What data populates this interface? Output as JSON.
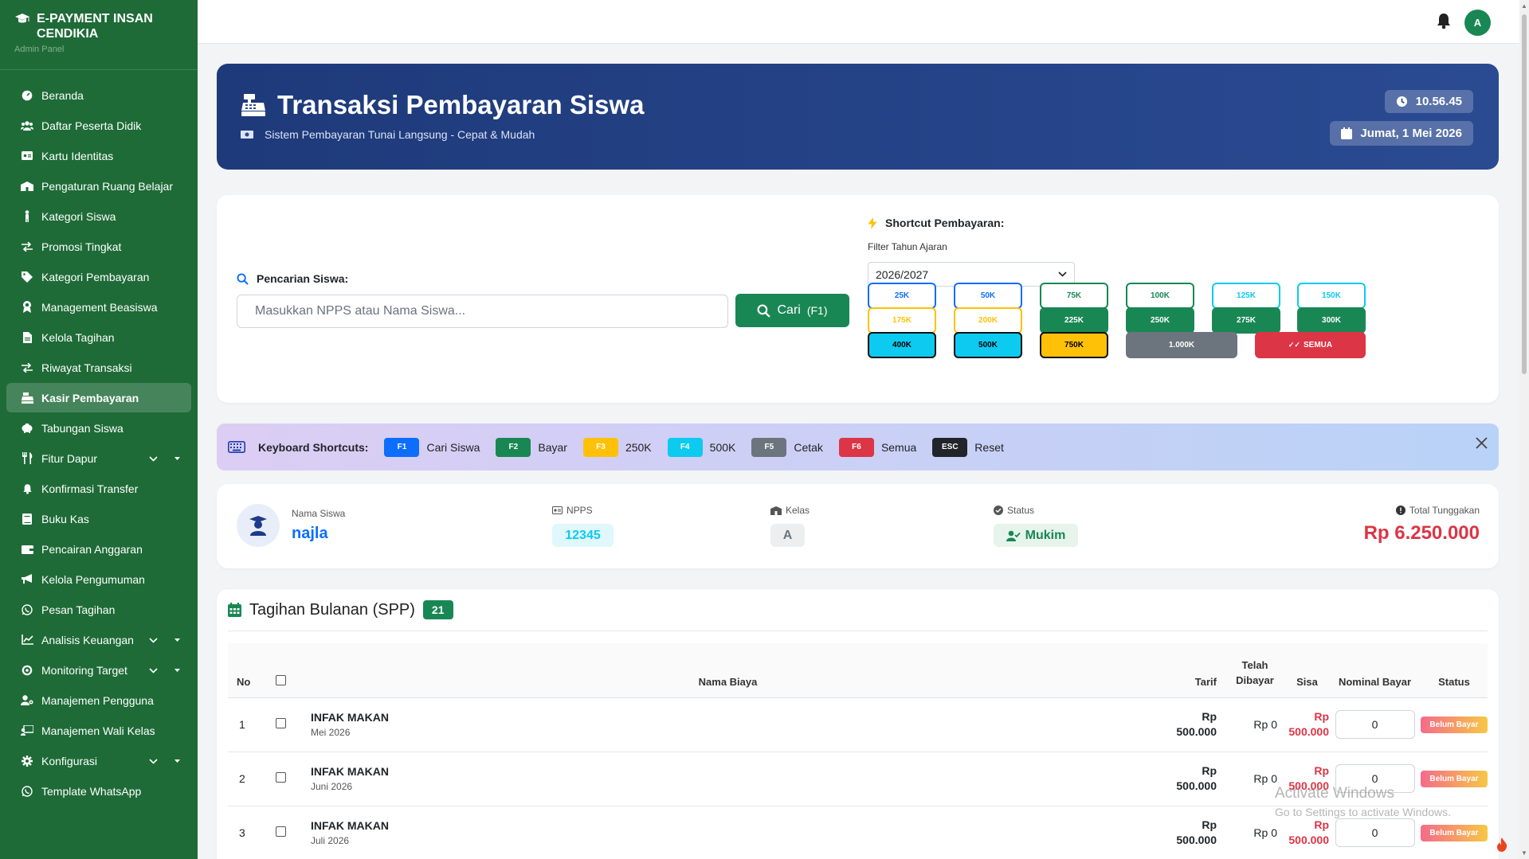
{
  "brand": {
    "title": "E-PAYMENT INSAN CENDIKIA",
    "subtitle": "Admin Panel"
  },
  "sidebar": {
    "items": [
      {
        "label": "Beranda",
        "icon": "gauge-icon"
      },
      {
        "label": "Daftar Peserta Didik",
        "icon": "users-icon"
      },
      {
        "label": "Kartu Identitas",
        "icon": "id-card-icon"
      },
      {
        "label": "Pengaturan Ruang Belajar",
        "icon": "school-icon"
      },
      {
        "label": "Kategori Siswa",
        "icon": "child-icon"
      },
      {
        "label": "Promosi Tingkat",
        "icon": "exchange-icon"
      },
      {
        "label": "Kategori Pembayaran",
        "icon": "tag-icon"
      },
      {
        "label": "Management Beasiswa",
        "icon": "award-icon"
      },
      {
        "label": "Kelola Tagihan",
        "icon": "file-icon"
      },
      {
        "label": "Riwayat Transaksi",
        "icon": "exchange-icon"
      },
      {
        "label": "Kasir Pembayaran",
        "icon": "cash-register-icon",
        "active": true
      },
      {
        "label": "Tabungan Siswa",
        "icon": "piggy-bank-icon"
      },
      {
        "label": "Fitur Dapur",
        "icon": "utensils-icon",
        "expandable": true
      },
      {
        "label": "Konfirmasi Transfer",
        "icon": "bell-icon"
      },
      {
        "label": "Buku Kas",
        "icon": "book-icon"
      },
      {
        "label": "Pencairan Anggaran",
        "icon": "wallet-icon"
      },
      {
        "label": "Kelola Pengumuman",
        "icon": "megaphone-icon"
      },
      {
        "label": "Pesan Tagihan",
        "icon": "whatsapp-icon"
      },
      {
        "label": "Analisis Keuangan",
        "icon": "chart-icon",
        "expandable": true
      },
      {
        "label": "Monitoring Target",
        "icon": "target-icon",
        "expandable": true
      },
      {
        "label": "Manajemen Pengguna",
        "icon": "user-gear-icon"
      },
      {
        "label": "Manajemen Wali Kelas",
        "icon": "teacher-icon"
      },
      {
        "label": "Konfigurasi",
        "icon": "gear-icon",
        "expandable": true
      },
      {
        "label": "Template WhatsApp",
        "icon": "whatsapp-icon"
      }
    ]
  },
  "topbar": {
    "avatar_letter": "A"
  },
  "hero": {
    "title": "Transaksi Pembayaran Siswa",
    "subtitle": "Sistem Pembayaran Tunai Langsung - Cepat & Mudah",
    "time": "10.56.45",
    "date": "Jumat, 1 Mei 2026"
  },
  "search": {
    "label": "Pencarian Siswa:",
    "placeholder": "Masukkan NPPS atau Nama Siswa...",
    "value": "",
    "button_label": "Cari",
    "button_key": "(F1)"
  },
  "shortcut": {
    "title": "Shortcut Pembayaran:",
    "filter_label": "Filter Tahun Ajaran",
    "filter_value": "2026/2027",
    "amounts": [
      {
        "label": "25K",
        "style": "outline",
        "color": "#0d6efd"
      },
      {
        "label": "50K",
        "style": "outline",
        "color": "#0d6efd"
      },
      {
        "label": "75K",
        "style": "outline",
        "color": "#198754"
      },
      {
        "label": "100K",
        "style": "outline",
        "color": "#198754"
      },
      {
        "label": "125K",
        "style": "outline",
        "color": "#0dcaf0"
      },
      {
        "label": "150K",
        "style": "outline",
        "color": "#0dcaf0"
      },
      {
        "label": "175K",
        "style": "outline",
        "color": "#ffc107"
      },
      {
        "label": "200K",
        "style": "outline",
        "color": "#ffc107"
      },
      {
        "label": "225K",
        "style": "solid",
        "color": "#198754"
      },
      {
        "label": "250K",
        "style": "solid",
        "color": "#198754"
      },
      {
        "label": "275K",
        "style": "solid",
        "color": "#198754"
      },
      {
        "label": "300K",
        "style": "solid",
        "color": "#198754"
      },
      {
        "label": "400K",
        "style": "solid",
        "color": "#0dcaf0"
      },
      {
        "label": "500K",
        "style": "solid",
        "color": "#0dcaf0"
      },
      {
        "label": "750K",
        "style": "solid",
        "color": "#ffc107"
      },
      {
        "label": "1.000K",
        "style": "solid",
        "color": "#6c757d"
      },
      {
        "label": "SEMUA",
        "style": "solid",
        "color": "#dc3545"
      }
    ]
  },
  "keyboard": {
    "title": "Keyboard Shortcuts:",
    "keys": [
      {
        "key": "F1",
        "desc": "Cari Siswa",
        "color": "#0d6efd"
      },
      {
        "key": "F2",
        "desc": "Bayar",
        "color": "#198754"
      },
      {
        "key": "F3",
        "desc": "250K",
        "color": "#ffc107"
      },
      {
        "key": "F4",
        "desc": "500K",
        "color": "#0dcaf0"
      },
      {
        "key": "F5",
        "desc": "Cetak",
        "color": "#6c757d"
      },
      {
        "key": "F6",
        "desc": "Semua",
        "color": "#dc3545"
      },
      {
        "key": "ESC",
        "desc": "Reset",
        "color": "#212529"
      }
    ]
  },
  "student": {
    "name_label": "Nama Siswa",
    "name": "najla",
    "npps_label": "NPPS",
    "npps": "12345",
    "kelas_label": "Kelas",
    "kelas": "A",
    "status_label": "Status",
    "status": "Mukim",
    "total_label": "Total Tunggakan",
    "total": "Rp 6.250.000"
  },
  "table": {
    "title": "Tagihan Bulanan (SPP)",
    "count": "21",
    "headers": {
      "no": "No",
      "nama": "Nama Biaya",
      "tarif": "Tarif",
      "telah": "Telah Dibayar",
      "sisa": "Sisa",
      "nominal": "Nominal Bayar",
      "status": "Status"
    },
    "rows": [
      {
        "no": "1",
        "nama": "INFAK MAKAN",
        "periode": "Mei 2026",
        "tarif_a": "Rp",
        "tarif_b": "500.000",
        "telah": "Rp 0",
        "sisa_a": "Rp",
        "sisa_b": "500.000",
        "nominal": "0",
        "status": "Belum Bayar"
      },
      {
        "no": "2",
        "nama": "INFAK MAKAN",
        "periode": "Juni 2026",
        "tarif_a": "Rp",
        "tarif_b": "500.000",
        "telah": "Rp 0",
        "sisa_a": "Rp",
        "sisa_b": "500.000",
        "nominal": "0",
        "status": "Belum Bayar"
      },
      {
        "no": "3",
        "nama": "INFAK MAKAN",
        "periode": "Juli 2026",
        "tarif_a": "Rp",
        "tarif_b": "500.000",
        "telah": "Rp 0",
        "sisa_a": "Rp",
        "sisa_b": "500.000",
        "nominal": "0",
        "status": "Belum Bayar"
      }
    ]
  },
  "watermark": {
    "line1": "Activate Windows",
    "line2": "Go to Settings to activate Windows."
  }
}
